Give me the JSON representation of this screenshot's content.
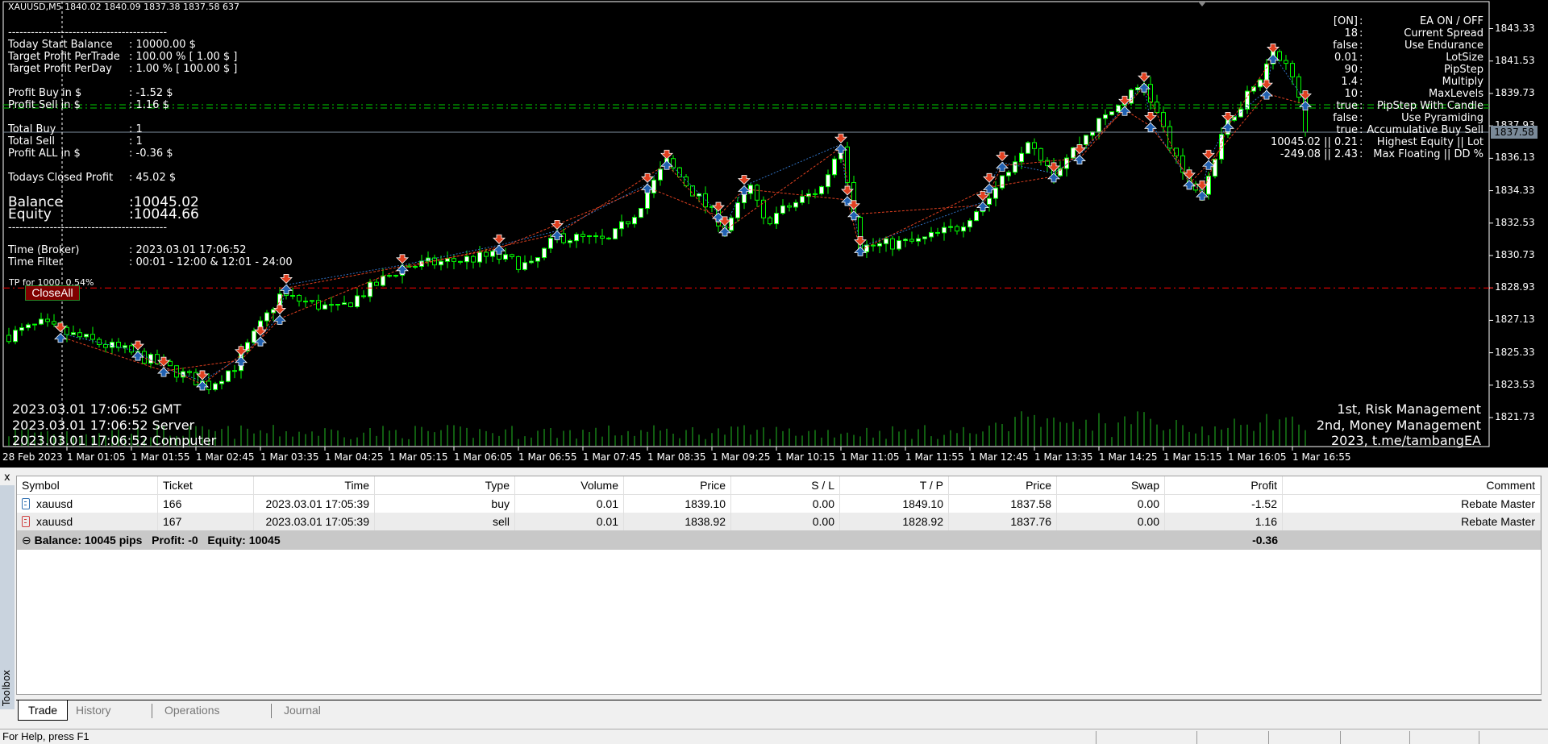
{
  "chart": {
    "header": "XAUUSD,M5  1840.02 1840.09 1837.38 1837.58  637",
    "left_panel": {
      "separator": "------------------------------------------",
      "rows": [
        {
          "label": "Today Start Balance",
          "value": ": 10000.00 $"
        },
        {
          "label": "Target Profit PerTrade",
          "value": ": 100.00 % [ 1.00 $ ]"
        },
        {
          "label": "Target Profit PerDay",
          "value": ": 1.00 % [ 100.00 $ ]"
        },
        {
          "label": "Profit Buy in $",
          "value": ": -1.52 $"
        },
        {
          "label": "Profit Sell in $",
          "value": ": 1.16 $"
        },
        {
          "label": "Total Buy",
          "value": ": 1"
        },
        {
          "label": "Total Sell",
          "value": ": 1"
        },
        {
          "label": "Profit ALL in $",
          "value": ": -0.36 $"
        },
        {
          "label": "Todays Closed Profit",
          "value": ": 45.02 $"
        },
        {
          "label": "Balance",
          "value": ":10045.02"
        },
        {
          "label": "Equity",
          "value": ":10044.66"
        },
        {
          "label": "Time (Broker)",
          "value": ": 2023.03.01 17:06:52"
        },
        {
          "label": "Time Filter",
          "value": ": 00:01 - 12:00 & 12:01 - 24:00"
        }
      ],
      "tp_note": "TP for 1000  0.54%",
      "close_all": "CloseAll"
    },
    "right_panel": [
      {
        "value": "[ON]",
        "label": "EA ON / OFF"
      },
      {
        "value": "18",
        "label": "Current Spread"
      },
      {
        "value": "false",
        "label": "Use Endurance"
      },
      {
        "value": "0.01",
        "label": "LotSize"
      },
      {
        "value": "90",
        "label": "PipStep"
      },
      {
        "value": "1.4",
        "label": "Multiply"
      },
      {
        "value": "10",
        "label": "MaxLevels"
      },
      {
        "value": "true",
        "label": "PipStep With Candle"
      },
      {
        "value": "false",
        "label": "Use Pyramiding"
      },
      {
        "value": "true",
        "label": "Accumulative Buy Sell"
      },
      {
        "value": "10045.02 || 0.21",
        "label": "Highest Equity || Lot"
      },
      {
        "value": "-249.08 || 2.43",
        "label": "Max Floating || DD %"
      }
    ],
    "clock": [
      "2023.03.01 17:06:52 GMT",
      "2023.03.01 17:06:52 Server",
      "2023.03.01 17:06:52 Computer"
    ],
    "credits": [
      "1st, Risk Management",
      "2nd, Money Management",
      "2023, t.me/tambangEA"
    ],
    "colors": {
      "bull": "#00ff00",
      "bear": "#00ff00",
      "buy_line": "#00cc00",
      "tp_line": "#ff0000",
      "price_line": "#8090a0",
      "sell_arrow": "#e04020",
      "buy_arrow": "#2060b0"
    }
  },
  "chart_data": {
    "type": "candlestick",
    "symbol": "XAUUSD",
    "timeframe": "M5",
    "ylim": [
      1820.9,
      1844.8
    ],
    "y_ticks": [
      "1843.33",
      "1841.53",
      "1839.73",
      "1837.93",
      "1836.13",
      "1834.33",
      "1832.53",
      "1830.73",
      "1828.93",
      "1827.13",
      "1825.33",
      "1823.53",
      "1821.73"
    ],
    "x_ticks": [
      "28 Feb 2023",
      "1 Mar 01:05",
      "1 Mar 01:55",
      "1 Mar 02:45",
      "1 Mar 03:35",
      "1 Mar 04:25",
      "1 Mar 05:15",
      "1 Mar 06:05",
      "1 Mar 06:55",
      "1 Mar 07:45",
      "1 Mar 08:35",
      "1 Mar 09:25",
      "1 Mar 10:15",
      "1 Mar 11:05",
      "1 Mar 11:55",
      "1 Mar 12:45",
      "1 Mar 13:35",
      "1 Mar 14:25",
      "1 Mar 15:15",
      "1 Mar 16:05",
      "1 Mar 16:55"
    ],
    "current_price": "1837.58",
    "close_path": [
      [
        "00:20",
        1826.3
      ],
      [
        "00:45",
        1826.9
      ],
      [
        "01:00",
        1826.5
      ],
      [
        "02:00",
        1825.2
      ],
      [
        "02:55",
        1823.5
      ],
      [
        "03:15",
        1824.6
      ],
      [
        "03:50",
        1828.5
      ],
      [
        "04:35",
        1827.7
      ],
      [
        "05:25",
        1830.1
      ],
      [
        "06:35",
        1830.7
      ],
      [
        "07:05",
        1830.1
      ],
      [
        "07:25",
        1831.8
      ],
      [
        "08:05",
        1831.5
      ],
      [
        "08:25",
        1833.1
      ],
      [
        "08:50",
        1835.9
      ],
      [
        "09:35",
        1832.3
      ],
      [
        "09:55",
        1834.5
      ],
      [
        "10:05",
        1832.6
      ],
      [
        "10:50",
        1834.5
      ],
      [
        "11:05",
        1837.0
      ],
      [
        "11:20",
        1831.2
      ],
      [
        "12:05",
        1831.5
      ],
      [
        "12:35",
        1832.3
      ],
      [
        "13:00",
        1833.95
      ],
      [
        "13:30",
        1837.3
      ],
      [
        "13:50",
        1835.4
      ],
      [
        "14:20",
        1837.8
      ],
      [
        "15:00",
        1840.3
      ],
      [
        "15:30",
        1835.1
      ],
      [
        "15:45",
        1834.2
      ],
      [
        "16:05",
        1838.1
      ],
      [
        "16:40",
        1841.9
      ],
      [
        "16:55",
        1841.0
      ],
      [
        "17:05",
        1837.58
      ]
    ],
    "trade_arrows": [
      [
        "01:00",
        1826.4
      ],
      [
        "02:00",
        1825.4
      ],
      [
        "02:20",
        1824.5
      ],
      [
        "02:50",
        1823.75
      ],
      [
        "03:20",
        1825.1
      ],
      [
        "03:35",
        1826.2
      ],
      [
        "03:50",
        1827.4
      ],
      [
        "03:55",
        1829.1
      ],
      [
        "05:25",
        1830.2
      ],
      [
        "06:40",
        1831.3
      ],
      [
        "07:25",
        1832.1
      ],
      [
        "08:35",
        1834.7
      ],
      [
        "08:50",
        1836.0
      ],
      [
        "09:30",
        1833.1
      ],
      [
        "09:35",
        1832.3
      ],
      [
        "09:50",
        1834.6
      ],
      [
        "11:05",
        1836.9
      ],
      [
        "11:10",
        1834.0
      ],
      [
        "11:15",
        1833.2
      ],
      [
        "11:20",
        1831.2
      ],
      [
        "12:55",
        1833.7
      ],
      [
        "13:00",
        1834.7
      ],
      [
        "13:10",
        1835.9
      ],
      [
        "13:50",
        1835.3
      ],
      [
        "14:10",
        1836.3
      ],
      [
        "14:45",
        1839.0
      ],
      [
        "15:00",
        1840.3
      ],
      [
        "15:05",
        1838.1
      ],
      [
        "15:35",
        1834.9
      ],
      [
        "15:45",
        1834.3
      ],
      [
        "15:50",
        1836.0
      ],
      [
        "16:05",
        1838.1
      ],
      [
        "16:35",
        1839.9
      ],
      [
        "16:40",
        1841.9
      ],
      [
        "17:05",
        1839.3
      ]
    ],
    "levels": {
      "buy_open": 1839.1,
      "sell_open": 1838.92,
      "bid": 1837.58,
      "tp": 1828.93
    }
  },
  "terminal": {
    "toolbox_label": "Toolbox",
    "close": "x",
    "columns": [
      "Symbol",
      "Ticket",
      "Time",
      "Type",
      "Volume",
      "Price",
      "S / L",
      "T / P",
      "Price",
      "Swap",
      "Profit",
      "Comment"
    ],
    "rows": [
      {
        "side": "buy",
        "cells": [
          "xauusd",
          "166",
          "2023.03.01 17:05:39",
          "buy",
          "0.01",
          "1839.10",
          "0.00",
          "1849.10",
          "1837.58",
          "0.00",
          "-1.52",
          "Rebate Master"
        ]
      },
      {
        "side": "sell",
        "cells": [
          "xauusd",
          "167",
          "2023.03.01 17:05:39",
          "sell",
          "0.01",
          "1838.92",
          "0.00",
          "1828.92",
          "1837.76",
          "0.00",
          "1.16",
          "Rebate Master"
        ]
      }
    ],
    "summary": {
      "text": "Balance: 10045 pips   Profit: -0   Equity: 10045",
      "profit": "-0.36"
    },
    "tabs": [
      "Trade",
      "History",
      "Operations",
      "Journal"
    ],
    "active_tab": "Trade"
  },
  "status": {
    "help": "For Help, press F1"
  }
}
